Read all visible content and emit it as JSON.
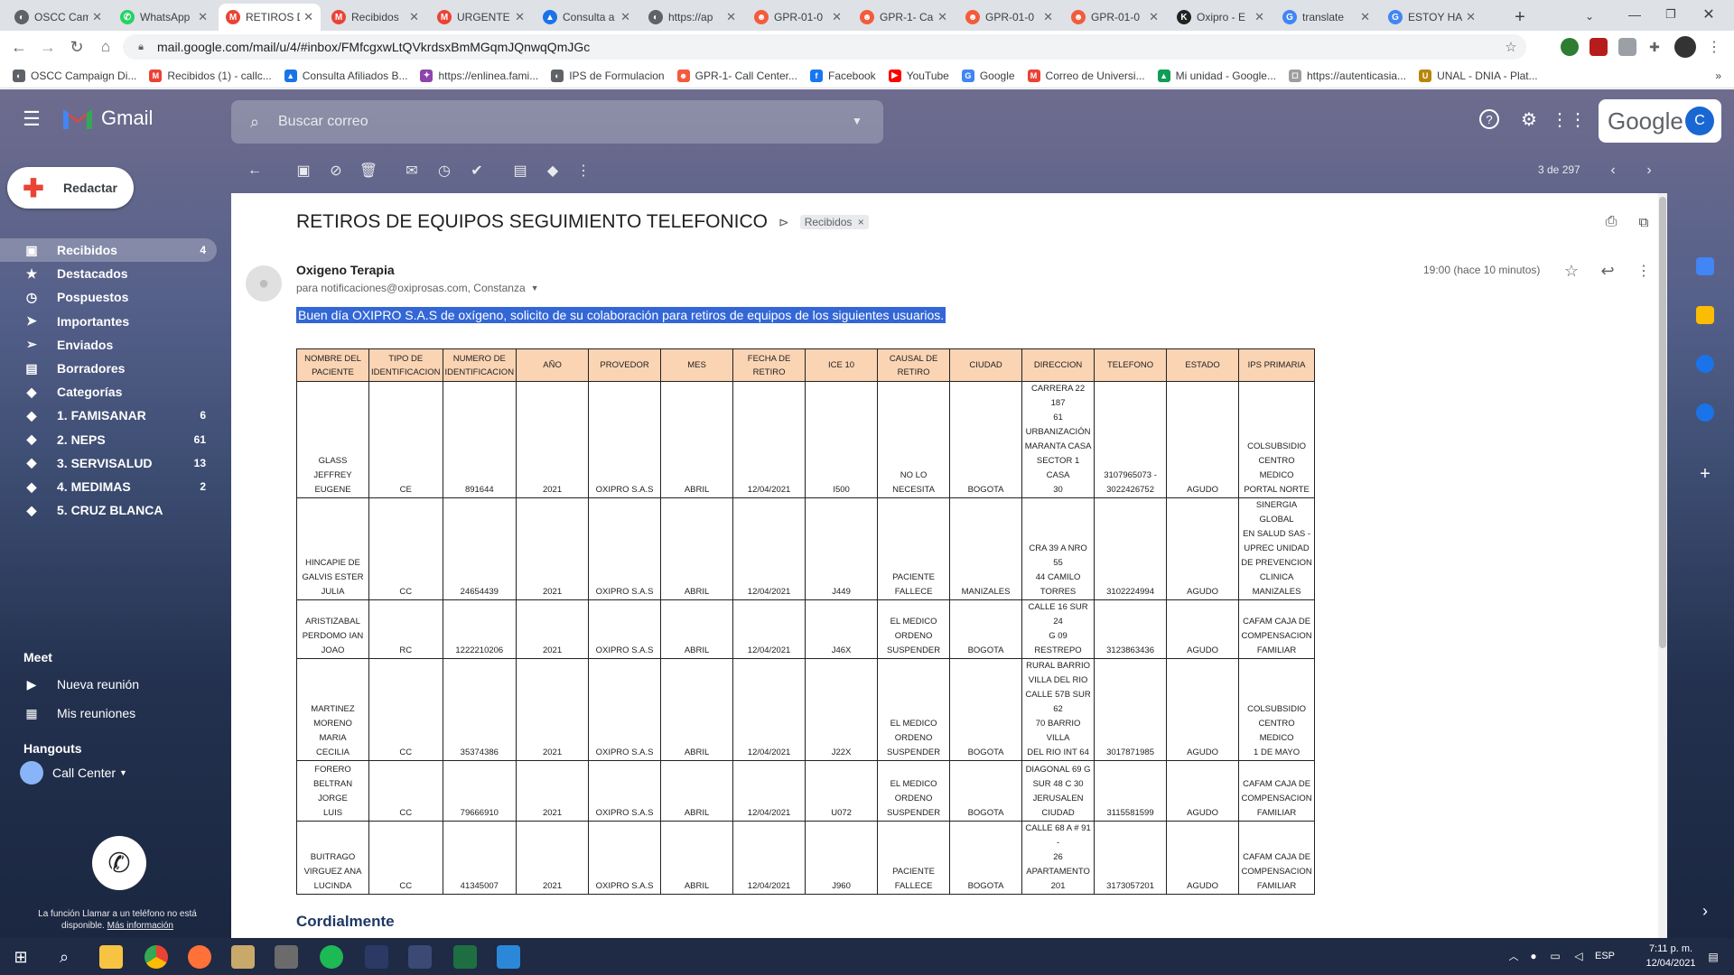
{
  "browser": {
    "tabs": [
      {
        "title": "OSCC Campaign",
        "fav": "#5f6368",
        "ficon": "◐"
      },
      {
        "title": "WhatsApp",
        "fav": "#25d366",
        "ficon": "✆"
      },
      {
        "title": "RETIROS DE",
        "fav": "#ea4335",
        "ficon": "M",
        "active": true
      },
      {
        "title": "Recibidos",
        "fav": "#ea4335",
        "ficon": "M"
      },
      {
        "title": "URGENTE",
        "fav": "#ea4335",
        "ficon": "M"
      },
      {
        "title": "Consulta a",
        "fav": "#1a73e8",
        "ficon": "▲"
      },
      {
        "title": "https://ap",
        "fav": "#5f6368",
        "ficon": "◐"
      },
      {
        "title": "GPR-01-0",
        "fav": "#f25c3c",
        "ficon": "☻"
      },
      {
        "title": "GPR-1- Ca",
        "fav": "#f25c3c",
        "ficon": "☻"
      },
      {
        "title": "GPR-01-0",
        "fav": "#f25c3c",
        "ficon": "☻"
      },
      {
        "title": "GPR-01-0",
        "fav": "#f25c3c",
        "ficon": "☻"
      },
      {
        "title": "Oxipro - E",
        "fav": "#222",
        "ficon": "K"
      },
      {
        "title": "translate",
        "fav": "#4285f4",
        "ficon": "G"
      },
      {
        "title": "ESTOY HA",
        "fav": "#4285f4",
        "ficon": "G"
      }
    ],
    "new_tab": "+",
    "url": "mail.google.com/mail/u/4/#inbox/FMfcgxwLtQVkrdsxBmMGqmJQnwqQmJGc",
    "bookmarks": [
      {
        "label": "OSCC Campaign Di...",
        "color": "#5f6368",
        "icon": "◐"
      },
      {
        "label": "Recibidos (1) - callc...",
        "color": "#ea4335",
        "icon": "M"
      },
      {
        "label": "Consulta Afiliados B...",
        "color": "#1a73e8",
        "icon": "▲"
      },
      {
        "label": "https://enlinea.fami...",
        "color": "#8e44ad",
        "icon": "✦"
      },
      {
        "label": "IPS de Formulacion",
        "color": "#5f6368",
        "icon": "◐"
      },
      {
        "label": "GPR-1- Call Center...",
        "color": "#f25c3c",
        "icon": "☻"
      },
      {
        "label": "Facebook",
        "color": "#1877f2",
        "icon": "f"
      },
      {
        "label": "YouTube",
        "color": "#ff0000",
        "icon": "▶"
      },
      {
        "label": "Google",
        "color": "#4285f4",
        "icon": "G"
      },
      {
        "label": "Correo de Universi...",
        "color": "#ea4335",
        "icon": "M"
      },
      {
        "label": "Mi unidad - Google...",
        "color": "#0f9d58",
        "icon": "▲"
      },
      {
        "label": "https://autenticasia...",
        "color": "#9e9e9e",
        "icon": "◻"
      },
      {
        "label": "UNAL - DNIA - Plat...",
        "color": "#b8860b",
        "icon": "U"
      }
    ]
  },
  "gmail": {
    "logo_text": "Gmail",
    "search_placeholder": "Buscar correo",
    "google_label": "Google",
    "avatar_letter": "C",
    "compose_label": "Redactar",
    "nav": [
      {
        "label": "Recibidos",
        "count": "4",
        "icon": "inbox-icon",
        "glyph": "▣",
        "selected": true
      },
      {
        "label": "Destacados",
        "count": "",
        "icon": "star-icon",
        "glyph": "★"
      },
      {
        "label": "Pospuestos",
        "count": "",
        "icon": "clock-icon",
        "glyph": "◷"
      },
      {
        "label": "Importantes",
        "count": "",
        "icon": "important-icon",
        "glyph": "➤"
      },
      {
        "label": "Enviados",
        "count": "",
        "icon": "send-icon",
        "glyph": "➢"
      },
      {
        "label": "Borradores",
        "count": "",
        "icon": "draft-icon",
        "glyph": "▤"
      },
      {
        "label": "Categorías",
        "count": "",
        "icon": "label-icon",
        "glyph": "◆"
      },
      {
        "label": "1. FAMISANAR",
        "count": "6",
        "icon": "label-icon",
        "glyph": "◆"
      },
      {
        "label": "2. NEPS",
        "count": "61",
        "icon": "label-icon",
        "glyph": "◆"
      },
      {
        "label": "3. SERVISALUD",
        "count": "13",
        "icon": "label-icon",
        "glyph": "◆"
      },
      {
        "label": "4. MEDIMAS",
        "count": "2",
        "icon": "label-icon",
        "glyph": "◆"
      },
      {
        "label": "5. CRUZ BLANCA",
        "count": "",
        "icon": "label-icon",
        "glyph": "◆"
      }
    ],
    "meet_title": "Meet",
    "meet_items": [
      {
        "label": "Nueva reunión",
        "glyph": "▶"
      },
      {
        "label": "Mis reuniones",
        "glyph": "▦"
      }
    ],
    "hangouts_title": "Hangouts",
    "hangouts_user": "Call Center",
    "call_notice_1": "La función Llamar a un teléfono no está",
    "call_notice_2": "disponible.",
    "call_notice_link": "Más información",
    "pager": "3 de 297",
    "subject": "RETIROS DE EQUIPOS SEGUIMIENTO TELEFONICO",
    "label_chip": "Recibidos",
    "sender": "Oxigeno Terapia",
    "recipients": "para notificaciones@oxiprosas.com, Constanza",
    "time": "19:00 (hace 10 minutos)",
    "body_line": "Buen día OXIPRO S.A.S de oxígeno, solicito de su colaboración para retiros de equipos de los siguientes usuarios.",
    "closing": "Cordialmente"
  },
  "table": {
    "headers": [
      [
        "NOMBRE DEL",
        "PACIENTE"
      ],
      [
        "TIPO DE",
        "IDENTIFICACION"
      ],
      [
        "NUMERO DE",
        "IDENTIFICACION"
      ],
      [
        "AÑO"
      ],
      [
        "PROVEDOR"
      ],
      [
        "MES"
      ],
      [
        "FECHA DE RETIRO"
      ],
      [
        "ICE 10"
      ],
      [
        "CAUSAL DE",
        "RETIRO"
      ],
      [
        "CIUDAD"
      ],
      [
        "DIRECCION"
      ],
      [
        "TELEFONO"
      ],
      [
        "ESTADO"
      ],
      [
        "IPS PRIMARIA"
      ]
    ],
    "rows": [
      [
        [
          "GLASS JEFFREY",
          "EUGENE"
        ],
        [
          "CE"
        ],
        [
          "891644"
        ],
        [
          "2021"
        ],
        [
          "OXIPRO S.A.S"
        ],
        [
          "ABRIL"
        ],
        [
          "12/04/2021"
        ],
        [
          "I500"
        ],
        [
          "NO LO NECESITA"
        ],
        [
          "BOGOTA"
        ],
        [
          "CARRERA 22 187",
          "61",
          "URBANIZACIÓN",
          "MARANTA CASA",
          "SECTOR 1 CASA",
          "30"
        ],
        [
          "3107965073 -",
          "3022426752"
        ],
        [
          "AGUDO"
        ],
        [
          "COLSUBSIDIO",
          "CENTRO MEDICO",
          "PORTAL NORTE"
        ]
      ],
      [
        [
          "HINCAPIE DE",
          "GALVIS ESTER",
          "JULIA"
        ],
        [
          "CC"
        ],
        [
          "24654439"
        ],
        [
          "2021"
        ],
        [
          "OXIPRO S.A.S"
        ],
        [
          "ABRIL"
        ],
        [
          "12/04/2021"
        ],
        [
          "J449"
        ],
        [
          "PACIENTE",
          "FALLECE"
        ],
        [
          "MANIZALES"
        ],
        [
          "CRA 39 A NRO 55",
          "44 CAMILO",
          "TORRES"
        ],
        [
          "3102224994"
        ],
        [
          "AGUDO"
        ],
        [
          "SINERGIA GLOBAL",
          "EN SALUD SAS -",
          "UPREC UNIDAD",
          "DE PREVENCION",
          "CLINICA",
          "MANIZALES"
        ]
      ],
      [
        [
          "ARISTIZABAL",
          "PERDOMO IAN",
          "JOAO"
        ],
        [
          "RC"
        ],
        [
          "1222210206"
        ],
        [
          "2021"
        ],
        [
          "OXIPRO S.A.S"
        ],
        [
          "ABRIL"
        ],
        [
          "12/04/2021"
        ],
        [
          "J46X"
        ],
        [
          "EL MEDICO",
          "ORDENO",
          "SUSPENDER"
        ],
        [
          "BOGOTA"
        ],
        [
          "CALLE 16 SUR 24",
          "G 09 RESTREPO"
        ],
        [
          "3123863436"
        ],
        [
          "AGUDO"
        ],
        [
          "CAFAM CAJA DE",
          "COMPENSACION",
          "FAMILIAR"
        ]
      ],
      [
        [
          "MARTINEZ",
          "MORENO MARIA",
          "CECILIA"
        ],
        [
          "CC"
        ],
        [
          "35374386"
        ],
        [
          "2021"
        ],
        [
          "OXIPRO S.A.S"
        ],
        [
          "ABRIL"
        ],
        [
          "12/04/2021"
        ],
        [
          "J22X"
        ],
        [
          "EL MEDICO",
          "ORDENO",
          "SUSPENDER"
        ],
        [
          "BOGOTA"
        ],
        [
          "RURAL BARRIO",
          "VILLA DEL RIO",
          "CALLE 57B SUR 62",
          "70 BARRIO VILLA",
          "DEL RIO INT 64"
        ],
        [
          "3017871985"
        ],
        [
          "AGUDO"
        ],
        [
          "COLSUBSIDIO",
          "CENTRO MEDICO",
          "1 DE MAYO"
        ]
      ],
      [
        [
          "FORERO",
          "BELTRAN JORGE",
          "LUIS"
        ],
        [
          "CC"
        ],
        [
          "79666910"
        ],
        [
          "2021"
        ],
        [
          "OXIPRO S.A.S"
        ],
        [
          "ABRIL"
        ],
        [
          "12/04/2021"
        ],
        [
          "U072"
        ],
        [
          "EL MEDICO",
          "ORDENO",
          "SUSPENDER"
        ],
        [
          "BOGOTA"
        ],
        [
          "DIAGONAL 69 G",
          "SUR 48 C 30",
          "JERUSALEN",
          "CIUDAD"
        ],
        [
          "3115581599"
        ],
        [
          "AGUDO"
        ],
        [
          "CAFAM CAJA DE",
          "COMPENSACION",
          "FAMILIAR"
        ]
      ],
      [
        [
          "BUITRAGO",
          "VIRGUEZ ANA",
          "LUCINDA"
        ],
        [
          "CC"
        ],
        [
          "41345007"
        ],
        [
          "2021"
        ],
        [
          "OXIPRO S.A.S"
        ],
        [
          "ABRIL"
        ],
        [
          "12/04/2021"
        ],
        [
          "J960"
        ],
        [
          "PACIENTE",
          "FALLECE"
        ],
        [
          "BOGOTA"
        ],
        [
          "CALLE 68 A # 91 -",
          "26",
          "APARTAMENTO",
          "201"
        ],
        [
          "3173057201"
        ],
        [
          "AGUDO"
        ],
        [
          "CAFAM CAJA DE",
          "COMPENSACION",
          "FAMILIAR"
        ]
      ]
    ]
  },
  "taskbar": {
    "language": "ESP",
    "time": "7:11 p. m.",
    "date": "12/04/2021"
  }
}
